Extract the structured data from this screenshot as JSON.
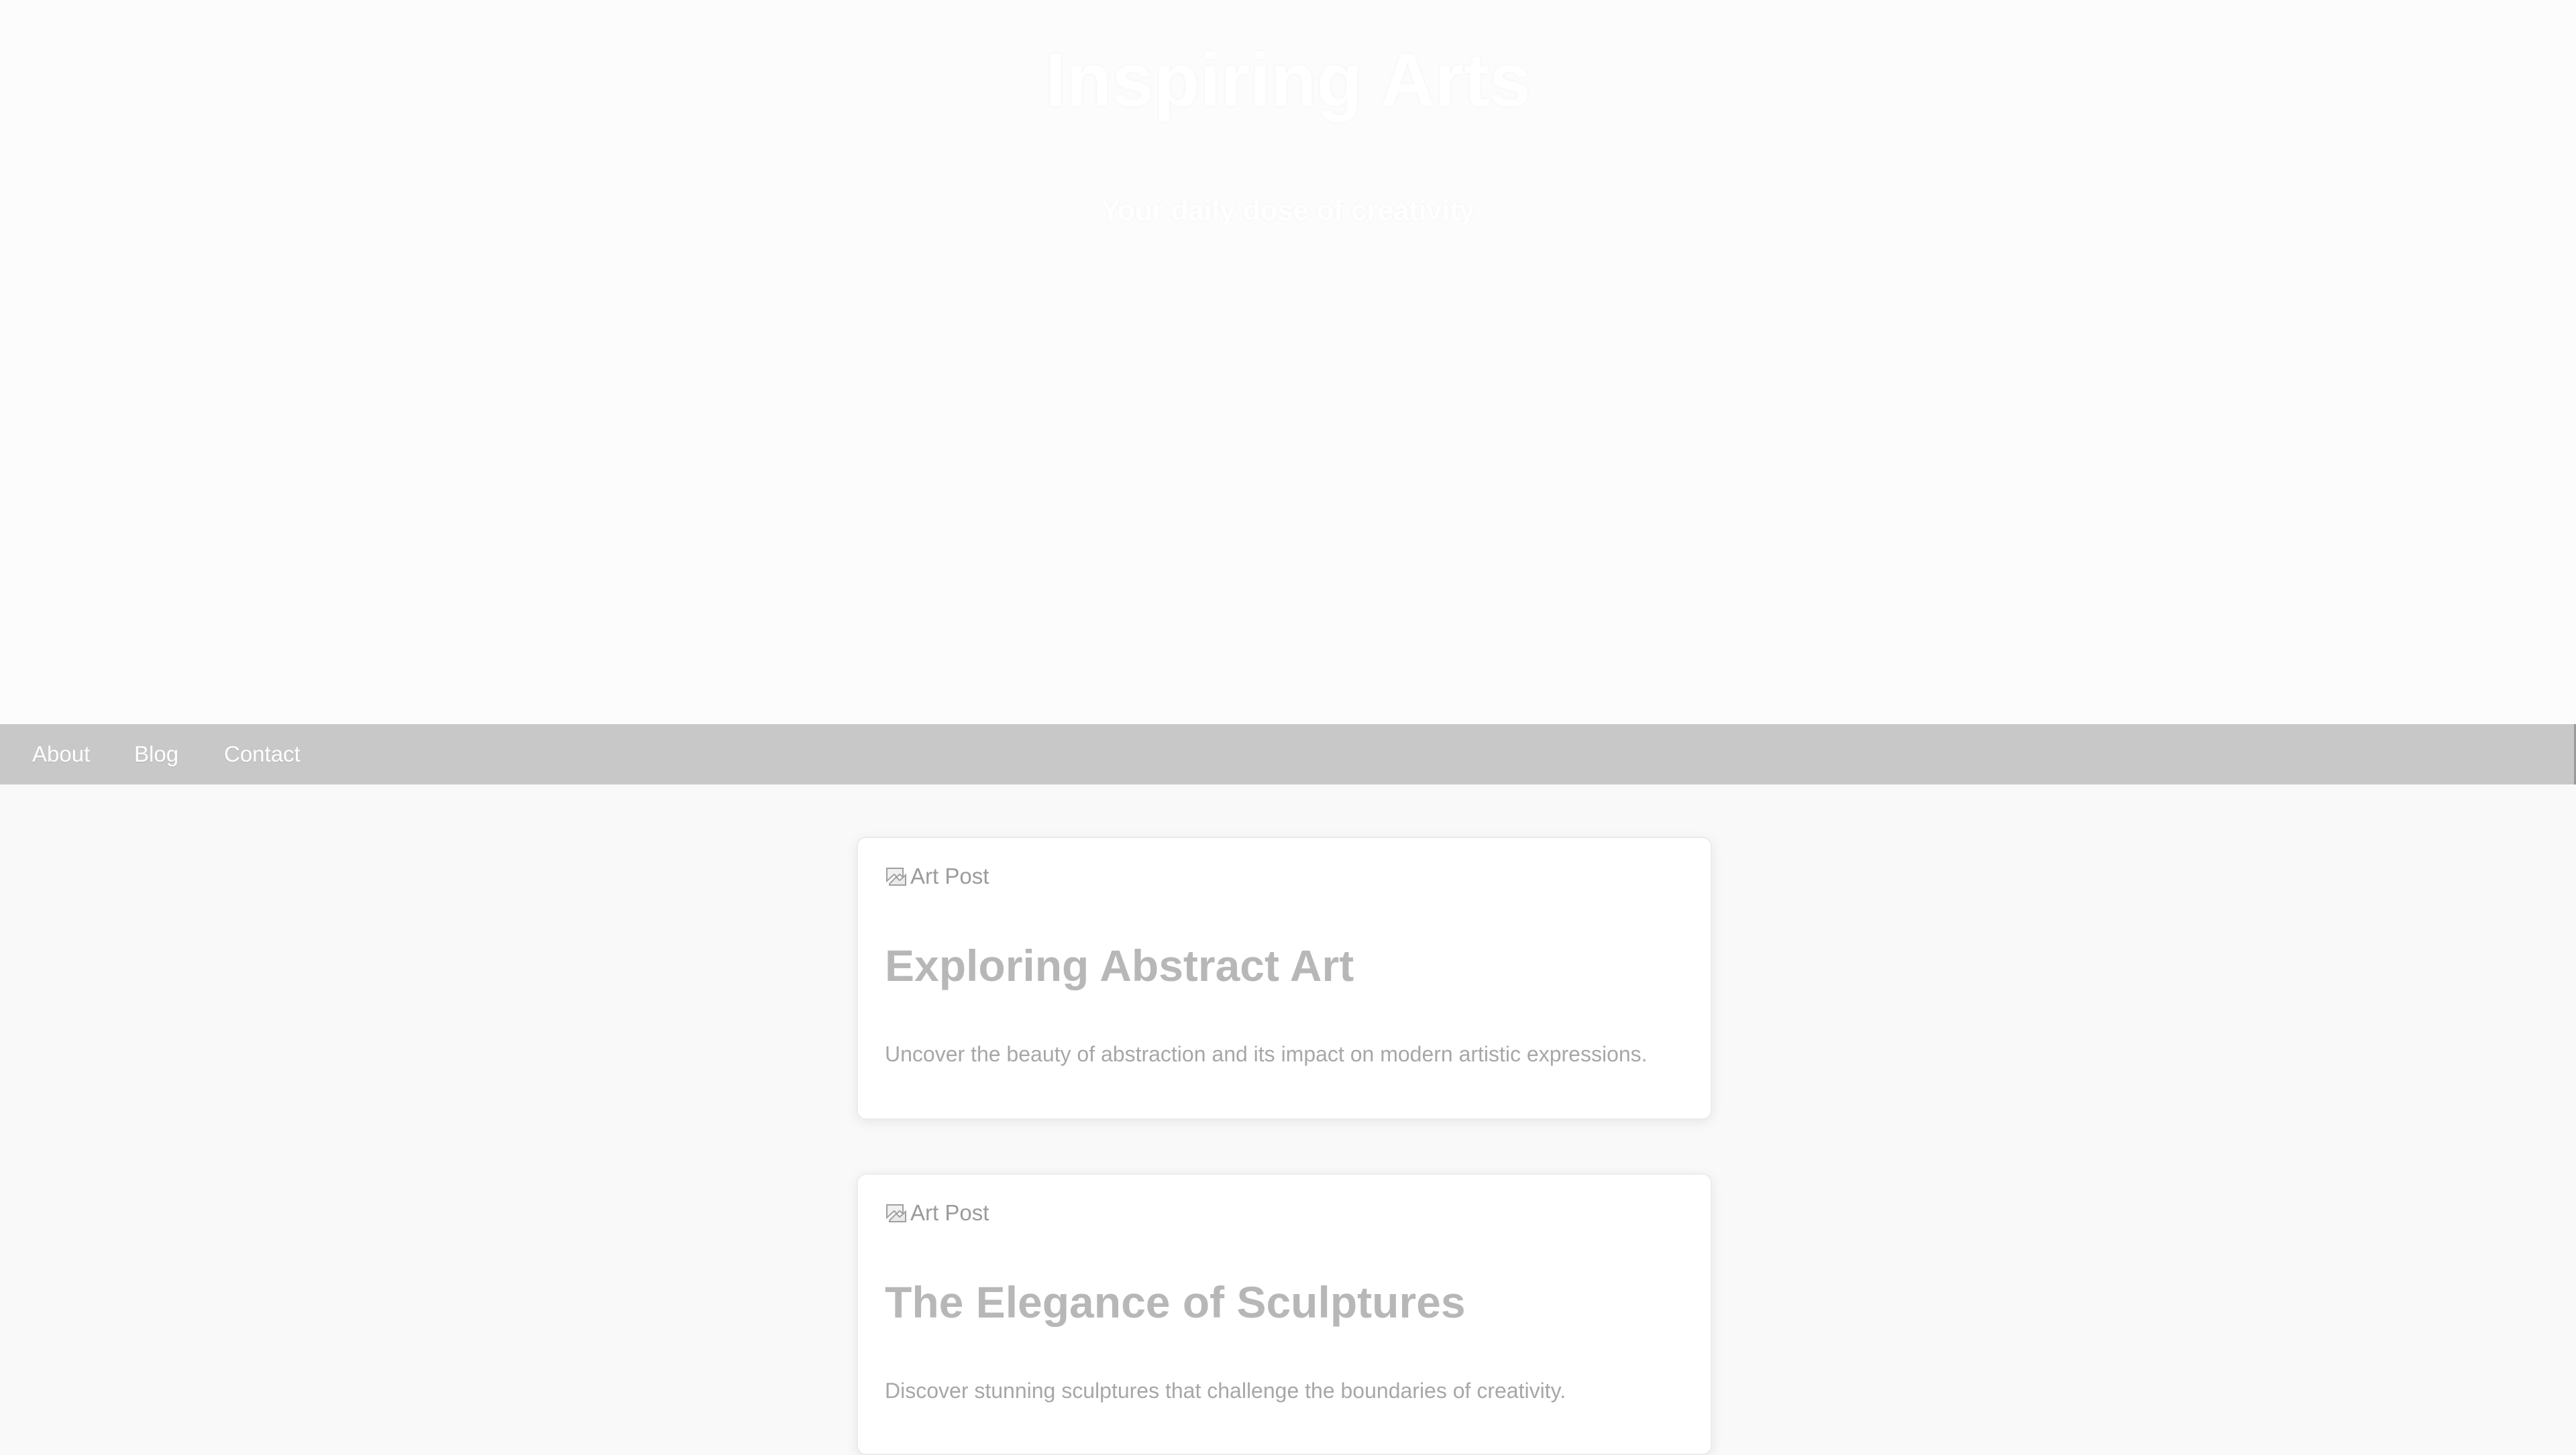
{
  "header": {
    "title": "Inspiring Arts",
    "subtitle": "Your daily dose of creativity"
  },
  "nav": {
    "about": "About",
    "blog": "Blog",
    "contact": "Contact"
  },
  "posts": [
    {
      "image_alt": "Art Post",
      "title": "Exploring Abstract Art",
      "summary": "Uncover the beauty of abstraction and its impact on modern artistic expressions."
    },
    {
      "image_alt": "Art Post",
      "title": "The Elegance of Sculptures",
      "summary": "Discover stunning sculptures that challenge the boundaries of creativity."
    }
  ],
  "icons": {
    "broken_image": "broken-image-icon"
  },
  "colors": {
    "navbar": "#c8c8c8",
    "background": "#f9f9f9",
    "card": "#ffffff"
  }
}
